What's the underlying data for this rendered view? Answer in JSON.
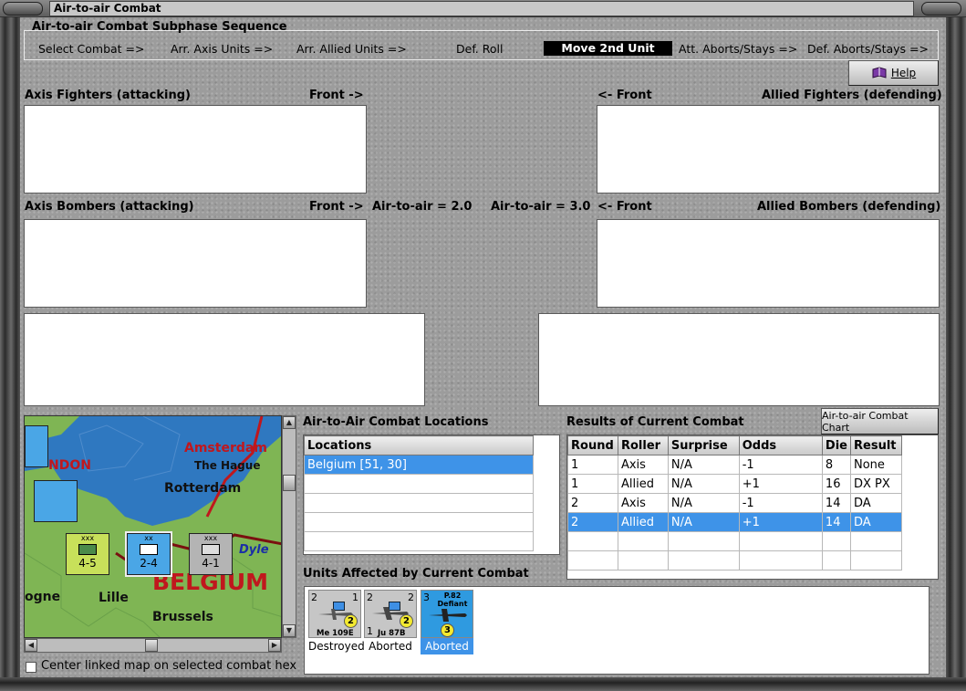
{
  "window": {
    "title": "Air-to-air Combat"
  },
  "sequence": {
    "title": "Air-to-air Combat Subphase Sequence",
    "steps": [
      "Select Combat =>",
      "Arr. Axis Units =>",
      "Arr. Allied Units =>",
      "Def. Roll",
      "Move 2nd Unit",
      "Att. Aborts/Stays =>",
      "Def. Aborts/Stays =>"
    ],
    "active_step": "Move 2nd Unit"
  },
  "help_button": {
    "label": "Help",
    "icon": "help-book-icon"
  },
  "labels": {
    "axis_fighters": "Axis Fighters (attacking)",
    "front_right": "Front ->",
    "front_left": "<- Front",
    "allied_fighters": "Allied Fighters (defending)",
    "axis_bombers": "Axis Bombers (attacking)",
    "front_right_b": "Front ->",
    "axis_air_to_air": "Air-to-air = 2.0",
    "allied_air_to_air": "Air-to-air = 3.0",
    "front_left_b": "<- Front",
    "allied_bombers": "Allied Bombers (defending)"
  },
  "map": {
    "places": [
      "Amsterdam",
      "The Hague",
      "Rotterdam",
      "Lille",
      "Brussels",
      "BELGIUM",
      "NDON",
      "ogne",
      "Dyle"
    ],
    "counters": [
      {
        "top": "xxx",
        "value": "4-5",
        "color": "#c8e05a",
        "icon": "infantry-icon"
      },
      {
        "top": "xx",
        "value": "2-4",
        "color": "#4aa6e6",
        "icon": "infantry-icon"
      },
      {
        "top": "xxx",
        "value": "4-1",
        "color": "#b4b4b4",
        "icon": "armor-icon"
      }
    ]
  },
  "locations": {
    "title": "Air-to-Air Combat Locations",
    "header": "Locations",
    "rows": [
      "Belgium [51, 30]",
      "",
      "",
      "",
      "",
      ""
    ],
    "selected": 0
  },
  "results": {
    "title": "Results of Current Combat",
    "chart_button": "Air-to-air Combat Chart",
    "columns": [
      "Round",
      "Roller",
      "Surprise",
      "Odds",
      "Die",
      "Result"
    ],
    "rows": [
      [
        "1",
        "Axis",
        "N/A",
        "-1",
        "8",
        "None"
      ],
      [
        "1",
        "Allied",
        "N/A",
        "+1",
        "16",
        "DX PX"
      ],
      [
        "2",
        "Axis",
        "N/A",
        "-1",
        "14",
        "DA"
      ],
      [
        "2",
        "Allied",
        "N/A",
        "+1",
        "14",
        "DA"
      ],
      [
        "",
        "",
        "",
        "",
        "",
        ""
      ],
      [
        "",
        "",
        "",
        "",
        "",
        ""
      ]
    ],
    "selected": 3
  },
  "affected": {
    "title": "Units Affected by Current Combat",
    "units": [
      {
        "name": "Me 109E",
        "left": "2",
        "right": "1",
        "circle": "2",
        "status": "Destroyed"
      },
      {
        "name": "Ju 87B",
        "left": "2",
        "right": "2",
        "circle": "2",
        "status": "Aborted",
        "extra": "1"
      },
      {
        "name": "P.82 Defiant",
        "left": "3",
        "circle": "3",
        "status": "Aborted"
      }
    ]
  },
  "center_map": {
    "label": "Center linked map on selected combat hex",
    "checked": false
  },
  "colors": {
    "selection": "#3e93e8",
    "active_step_bg": "#000000",
    "map_sea": "#2f78c0",
    "map_land": "#7fb554",
    "belgium_text": "#c0171d"
  }
}
